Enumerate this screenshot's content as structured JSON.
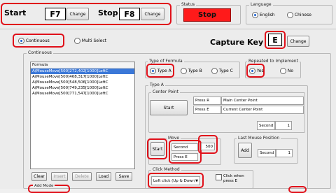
{
  "hotkeys": {
    "start_label": "Start",
    "start_key": "F7",
    "stop_label": "Stop",
    "stop_key": "F8",
    "change_label": "Change"
  },
  "status": {
    "group_label": "Status",
    "value": "Stop",
    "color": "#ff1a1a"
  },
  "language": {
    "group_label": "Language",
    "options": [
      "English",
      "Chinese"
    ],
    "selected": "English"
  },
  "mode": {
    "options": [
      "Continuous",
      "Multi Select"
    ],
    "selected": "Continuous"
  },
  "capture": {
    "label": "Capture Key",
    "key": "E",
    "change_label": "Change"
  },
  "continuous": {
    "group_label": "Continuous",
    "list_header": "Formula",
    "items": [
      "A(MouseMove[500]272,402[1000]LeftC",
      "A(MouseMove[500]468,317[1000]LeftC",
      "A(MouseMove[500]548,506[1000]LeftC",
      "A(MouseMove[500]749,235[1000]LeftC",
      "A(MouseMove[500]771,547[1000]LeftC"
    ],
    "selected_index": 0,
    "buttons": [
      "Clear",
      "Insert",
      "Delete",
      "Load",
      "Save"
    ]
  },
  "formula_type": {
    "group_label": "Type of Formula",
    "options": [
      "Type A",
      "Type B",
      "Type C"
    ],
    "selected": "Type A"
  },
  "repeat": {
    "group_label": "Repeated to Implement",
    "options": [
      "Yes",
      "No"
    ],
    "selected": "Yes"
  },
  "type_a": {
    "group_label": "Type A",
    "center_point": {
      "group_label": "Center Point",
      "start_label": "Start",
      "rows": [
        {
          "key": "Press R",
          "desc": "Main Center Point"
        },
        {
          "key": "Press E",
          "desc": "Current Center Point"
        }
      ],
      "second_label": "Second",
      "second_value": "1"
    },
    "move": {
      "group_label": "Move",
      "start_label": "Start",
      "second_label": "Second",
      "second_value": "500",
      "press_label": "Press E"
    },
    "last_mouse": {
      "group_label": "Last Mouse Position",
      "add_label": "Add",
      "second_label": "Second",
      "second_value": "1"
    },
    "click": {
      "group_label": "Click Method",
      "selected": "Left click (Up & Down)",
      "checkbox_label": "Click when press E"
    }
  },
  "bottom_label": "Add Mode"
}
